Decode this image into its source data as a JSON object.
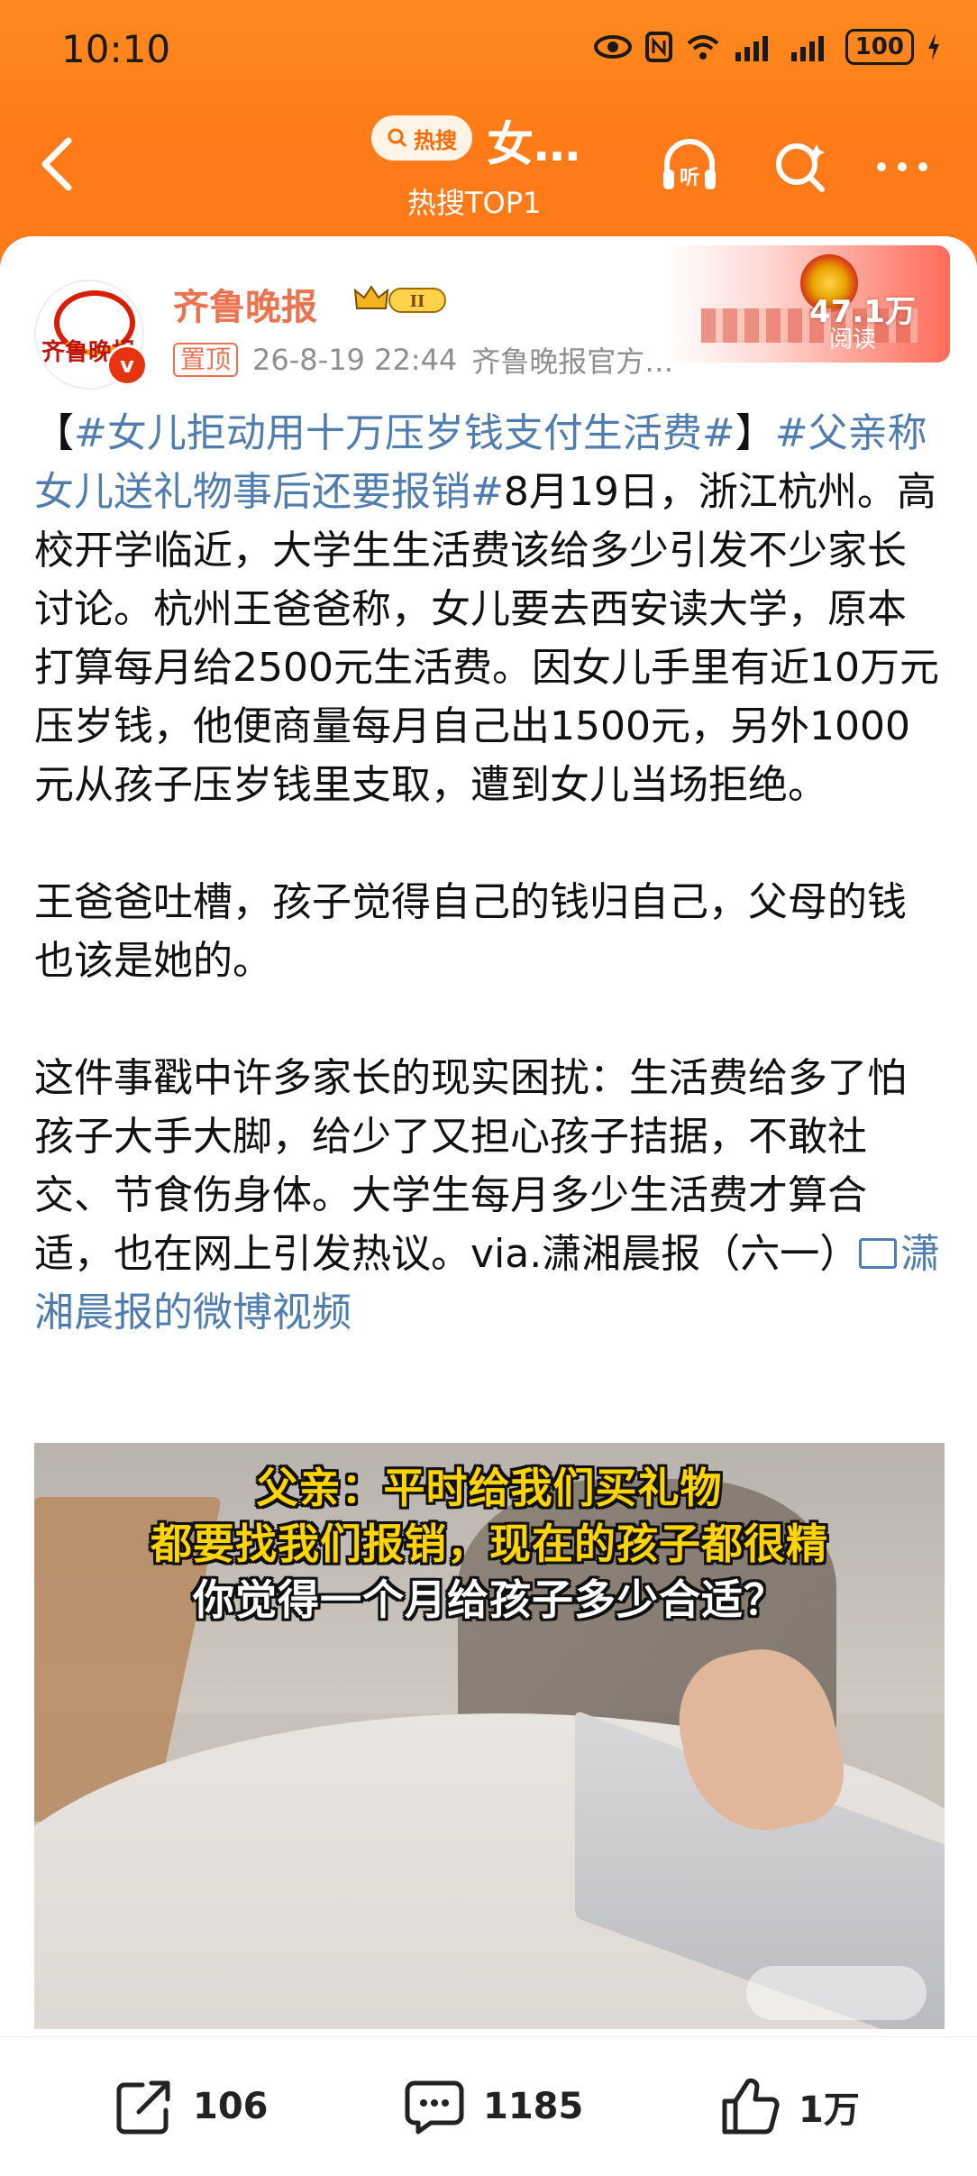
{
  "status_bar": {
    "time": "10:10",
    "battery": "100"
  },
  "header": {
    "badge_label": "热搜",
    "title": "女…",
    "subtitle": "热搜TOP1"
  },
  "post": {
    "author": "齐鲁晚报",
    "avatar_text": "齐鲁晚报",
    "pinned_label": "置顶",
    "datetime": "26-8-19 22:44",
    "source": "齐鲁晚报官方…",
    "read_count": "47.1万",
    "read_label": "阅读",
    "para1": [
      {
        "text": "【",
        "tag": false
      },
      {
        "text": "#女儿拒动用十万压岁钱支付生活费#",
        "tag": true
      },
      {
        "text": "】",
        "tag": false
      },
      {
        "text": "#父亲称女儿送礼物事后还要报销#",
        "tag": true
      },
      {
        "text": "8月19日，浙江杭州。高校开学临近，大学生生活费该给多少引发不少家长讨论。杭州王爸爸称，女儿要去西安读大学，原本打算每月给2500元生活费。因女儿手里有近10万元压岁钱，他便商量每月自己出1500元，另外1000元从孩子压岁钱里支取，遭到女儿当场拒绝。",
        "tag": false
      }
    ],
    "para2": "王爸爸吐槽，孩子觉得自己的钱归自己，父母的钱也该是她的。",
    "para3": "这件事戳中许多家长的现实困扰：生活费给多了怕孩子大手大脚，给少了又担心孩子拮据，不敢社交、节食伤身体。大学生每月多少生活费才算合适，也在网上引发热议。via.潇湘晨报（六一）",
    "video_link": "潇湘晨报的微博视频"
  },
  "video": {
    "caption_line1": "父亲：平时给我们买礼物",
    "caption_line2": "都要找我们报销，现在的孩子都很精",
    "caption_line3": "你觉得一个月给孩子多少合适？"
  },
  "actions": {
    "share_count": "106",
    "comment_count": "1185",
    "like_count": "1万"
  }
}
